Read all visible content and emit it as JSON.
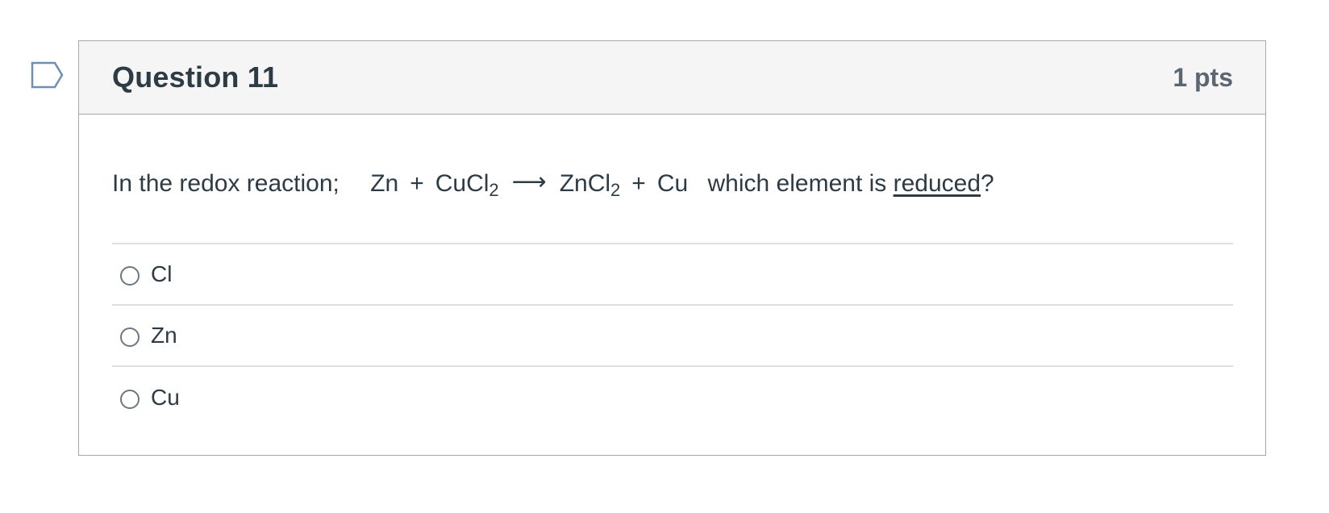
{
  "question": {
    "title": "Question 11",
    "points": "1 pts",
    "flag_icon": "flag-question-icon",
    "text": {
      "intro": "In the redox reaction;",
      "reactant1": "Zn",
      "plus1": "+",
      "reactant2_base": "CuCl",
      "reactant2_sub": "2",
      "arrow": "⟶",
      "product1_base": "ZnCl",
      "product1_sub": "2",
      "plus2": "+",
      "product2": "Cu",
      "question_pre": "which element is",
      "question_emphasis": "reduced",
      "question_post": "?"
    },
    "answers": [
      {
        "label": "Cl",
        "selected": false
      },
      {
        "label": "Zn",
        "selected": false
      },
      {
        "label": "Cu",
        "selected": false
      }
    ]
  },
  "colors": {
    "header_bg": "#f5f5f5",
    "border": "#a5a9ab",
    "divider": "#dcdedf",
    "text": "#2d3b45",
    "points_text": "#5b6670",
    "flag_stroke": "#6f8fb3"
  }
}
